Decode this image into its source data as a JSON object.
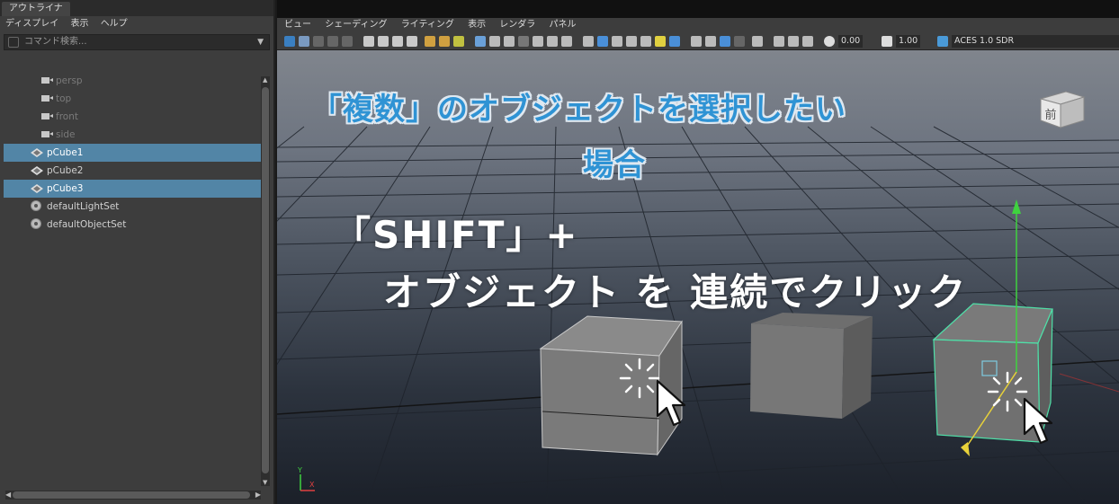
{
  "outliner": {
    "tab": "アウトライナ",
    "menu": [
      "ディスプレイ",
      "表示",
      "ヘルプ"
    ],
    "search_placeholder": "コマンド検索...",
    "items": [
      {
        "label": "persp",
        "icon": "camera-icon",
        "selected": false,
        "dim": true
      },
      {
        "label": "top",
        "icon": "camera-icon",
        "selected": false,
        "dim": true
      },
      {
        "label": "front",
        "icon": "camera-icon",
        "selected": false,
        "dim": true
      },
      {
        "label": "side",
        "icon": "camera-icon",
        "selected": false,
        "dim": true
      },
      {
        "label": "pCube1",
        "icon": "mesh-icon",
        "selected": true,
        "dim": false
      },
      {
        "label": "pCube2",
        "icon": "mesh-icon",
        "selected": false,
        "dim": false
      },
      {
        "label": "pCube3",
        "icon": "mesh-icon",
        "selected": true,
        "dim": false
      },
      {
        "label": "defaultLightSet",
        "icon": "set-icon",
        "selected": false,
        "dim": false
      },
      {
        "label": "defaultObjectSet",
        "icon": "set-icon",
        "selected": false,
        "dim": false
      }
    ]
  },
  "viewport": {
    "menu": [
      "ビュー",
      "シェーディング",
      "ライティング",
      "表示",
      "レンダラ",
      "パネル"
    ],
    "toolbar": {
      "field1": "0.00",
      "field2": "1.00",
      "colorspace": "ACES 1.0 SDR"
    },
    "viewcube_label": "前",
    "caption": {
      "line1": "「複数」のオブジェクトを選択したい",
      "line2": "場合",
      "line3": "「SHIFT」+",
      "line4": "オブジェクト を 連続でクリック"
    },
    "axis": {
      "y": "Y",
      "x": "X"
    }
  },
  "colors": {
    "selection": "#5285a6",
    "caption_blue": "#2f93d4",
    "selected_wire": "#4fe0a8",
    "manip_y": "#3fd23f",
    "manip_z": "#e8d23a"
  }
}
